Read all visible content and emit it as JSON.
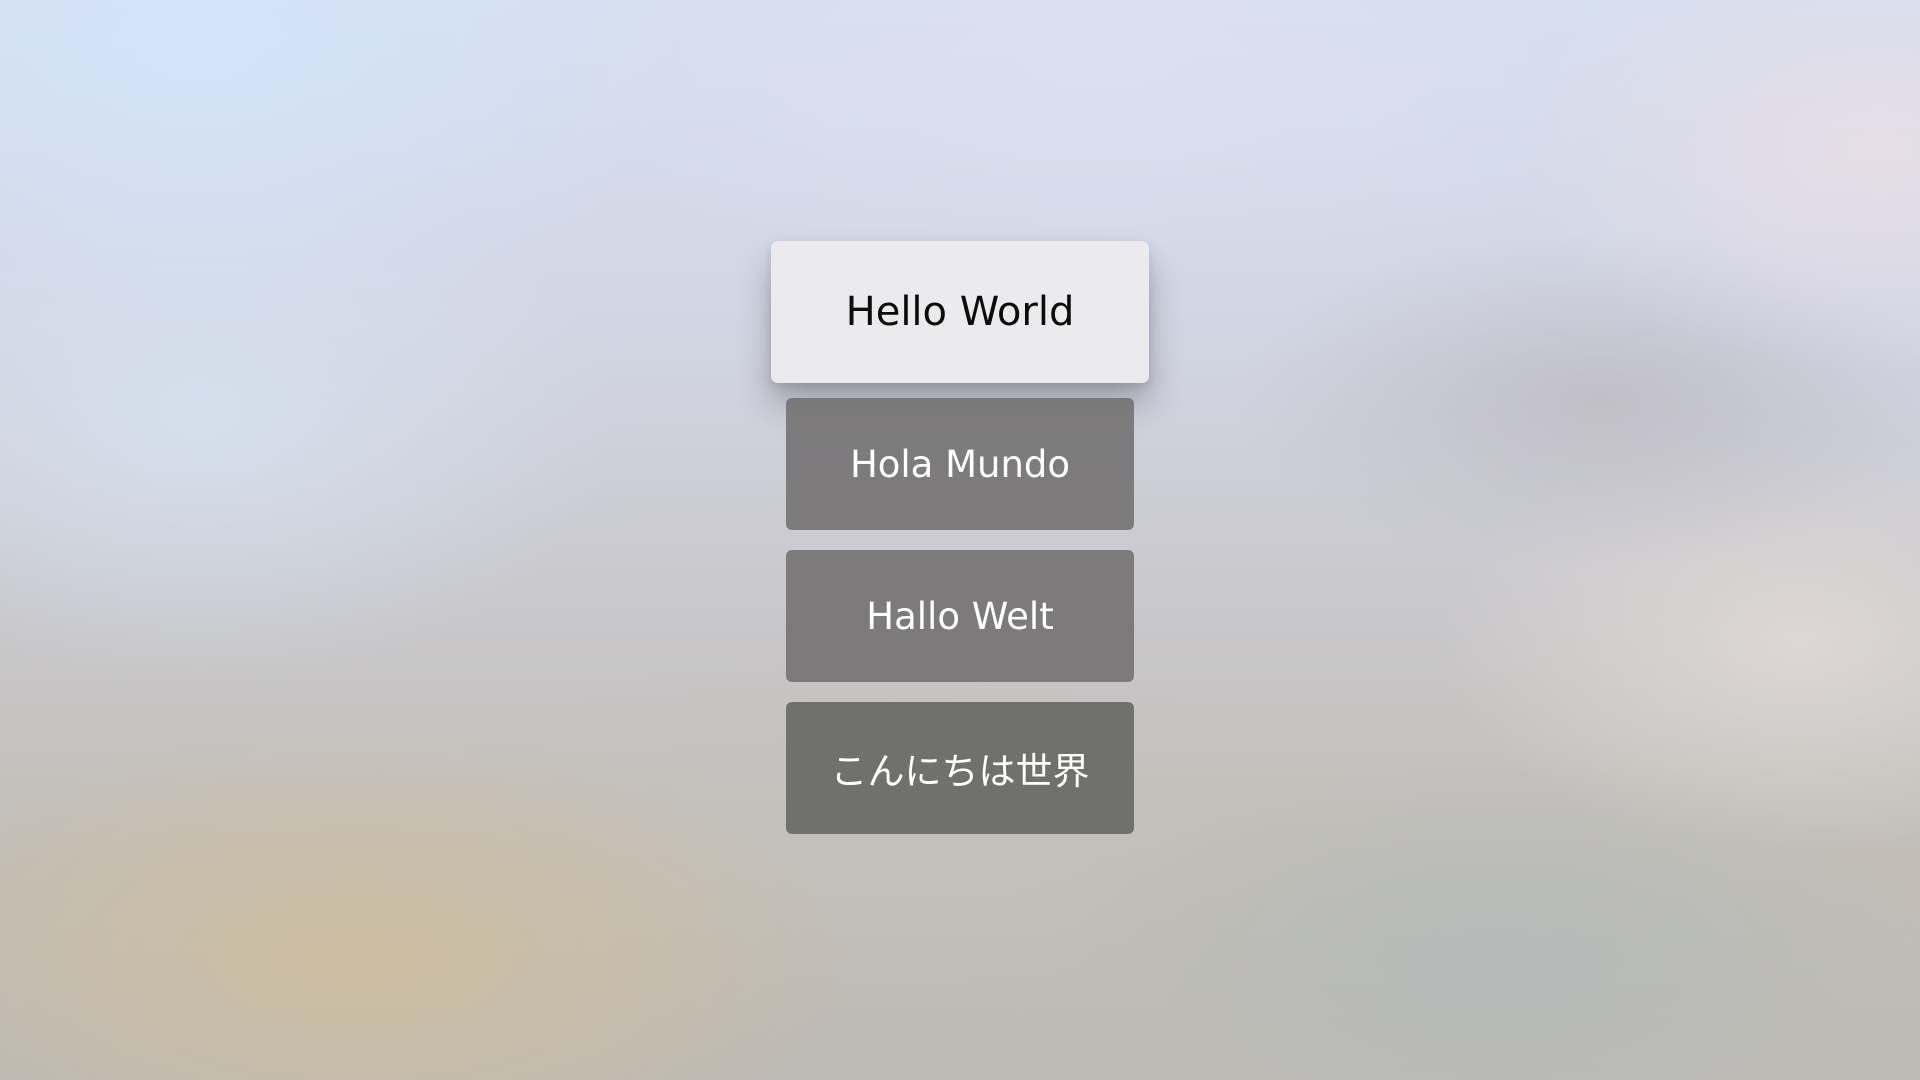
{
  "screen": {
    "menu": {
      "items": [
        {
          "label": "Hello World",
          "focused": true
        },
        {
          "label": "Hola Mundo",
          "focused": false
        },
        {
          "label": "Hallo Welt",
          "focused": false
        },
        {
          "label": "こんにちは世界",
          "focused": false
        }
      ]
    }
  },
  "colors": {
    "focused_button": "#ebebee",
    "unfocused_button": "#706e6e",
    "focused_text": "#0c0c0c",
    "unfocused_text": "#ffffff"
  }
}
